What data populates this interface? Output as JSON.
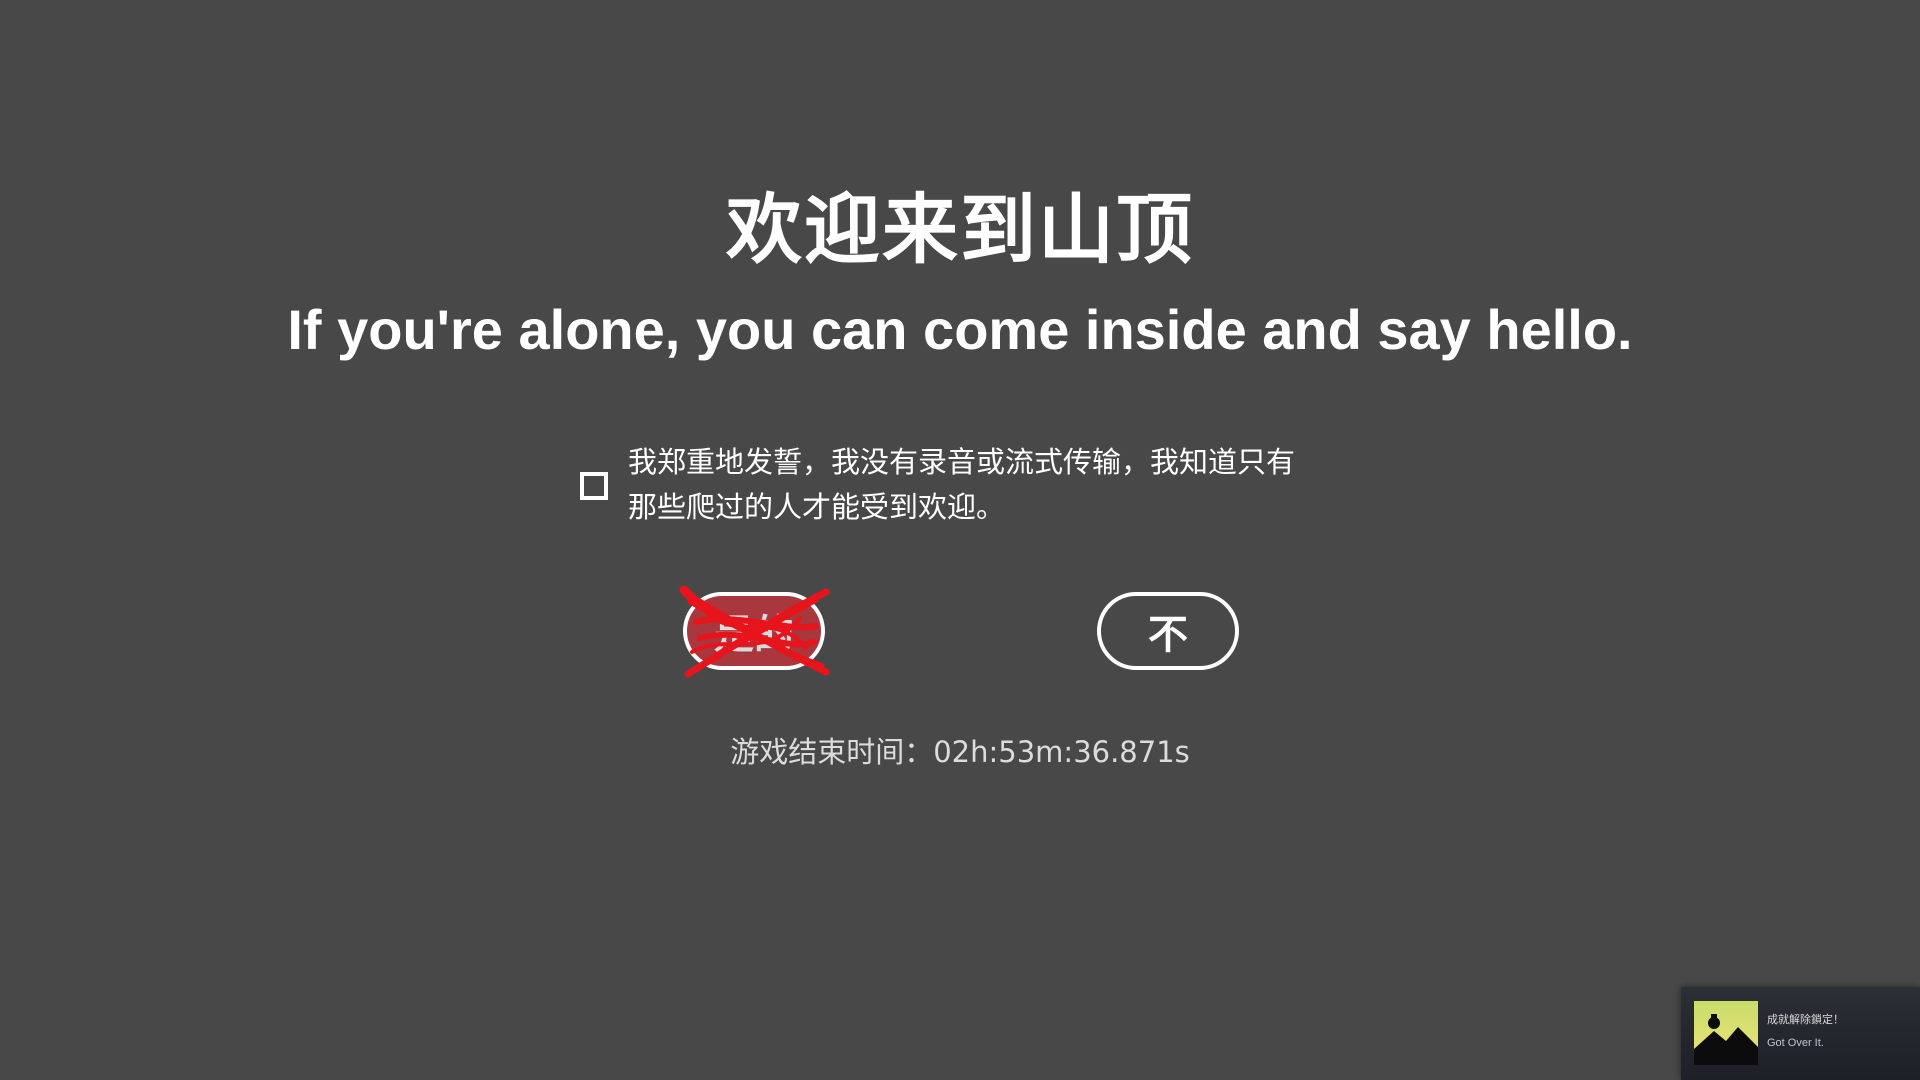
{
  "header": {
    "title": "欢迎来到山顶",
    "subtitle": "If you're alone, you can come inside and say hello."
  },
  "oath": {
    "checked": false,
    "text_line1": "我郑重地发誓，我没有录音或流式传输，我知道只有",
    "text_line2": "那些爬过的人才能受到欢迎。"
  },
  "buttons": {
    "yes_label": "是的",
    "no_label": "不"
  },
  "timer": {
    "text": "游戏结束时间：02h:53m:36.871s"
  },
  "toast": {
    "title": "成就解除鎖定！",
    "game": "Got Over It."
  },
  "colors": {
    "background": "#484848",
    "yes_button": "#a8383d",
    "scribble": "#e8141c",
    "text": "#ffffff"
  }
}
